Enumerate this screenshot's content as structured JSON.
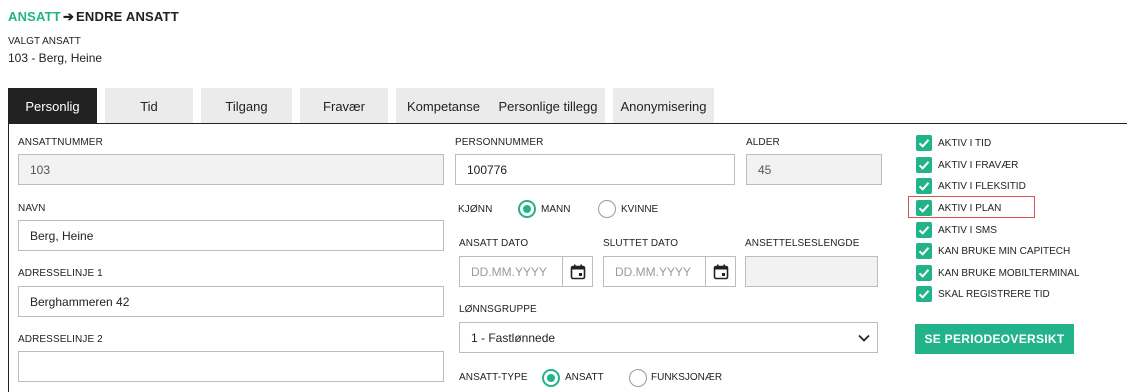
{
  "breadcrumb": {
    "link": "ANSATT",
    "separator": "➔",
    "current": "ENDRE ANSATT"
  },
  "selected_employee": {
    "label": "VALGT ANSATT",
    "value": "103 - Berg, Heine"
  },
  "tabs": [
    {
      "label": "Personlig",
      "active": true
    },
    {
      "label": "Tid",
      "active": false
    },
    {
      "label": "Tilgang",
      "active": false
    },
    {
      "label": "Fravær",
      "active": false
    },
    {
      "label": "Kompetanse",
      "active": false
    },
    {
      "label": "Personlige tillegg",
      "active": false
    },
    {
      "label": "Anonymisering",
      "active": false
    }
  ],
  "form": {
    "ansattnummer": {
      "label": "ANSATTNUMMER",
      "value": "103"
    },
    "personnummer": {
      "label": "PERSONNUMMER",
      "value": "100776"
    },
    "alder": {
      "label": "ALDER",
      "value": "45"
    },
    "navn": {
      "label": "NAVN",
      "value": "Berg, Heine"
    },
    "kjonn": {
      "label": "KJØNN",
      "options": [
        "MANN",
        "KVINNE"
      ],
      "selected": "MANN"
    },
    "adresselinje1": {
      "label": "ADRESSELINJE 1",
      "value": "Berghammeren 42"
    },
    "adresselinje2": {
      "label": "ADRESSELINJE 2",
      "value": ""
    },
    "ansatt_dato": {
      "label": "ANSATT DATO",
      "placeholder": "DD.MM.YYYY"
    },
    "sluttet_dato": {
      "label": "SLUTTET DATO",
      "placeholder": "DD.MM.YYYY"
    },
    "ansettelseslengde": {
      "label": "ANSETTELSESLENGDE",
      "value": ""
    },
    "lonnsgruppe": {
      "label": "LØNNSGRUPPE",
      "value": "1 - Fastlønnede"
    },
    "ansatt_type": {
      "label": "ANSATT-TYPE",
      "options": [
        "ANSATT",
        "FUNKSJONÆR"
      ],
      "selected": "ANSATT"
    }
  },
  "checkboxes": [
    {
      "label": "AKTIV I TID",
      "checked": true
    },
    {
      "label": "AKTIV I FRAVÆR",
      "checked": true
    },
    {
      "label": "AKTIV I FLEKSITID",
      "checked": true
    },
    {
      "label": "AKTIV I PLAN",
      "checked": true,
      "highlighted": true
    },
    {
      "label": "AKTIV I SMS",
      "checked": true
    },
    {
      "label": "KAN BRUKE MIN CAPITECH",
      "checked": true
    },
    {
      "label": "KAN BRUKE MOBILTERMINAL",
      "checked": true
    },
    {
      "label": "SKAL REGISTRERE TID",
      "checked": true
    }
  ],
  "period_button": {
    "label": "SE PERIODEOVERSIKT"
  },
  "colors": {
    "accent": "#22b38a",
    "active_tab": "#222222",
    "tab": "#ebebeb",
    "highlight": "#d9534f",
    "readonly_bg": "#f2f2f2"
  }
}
